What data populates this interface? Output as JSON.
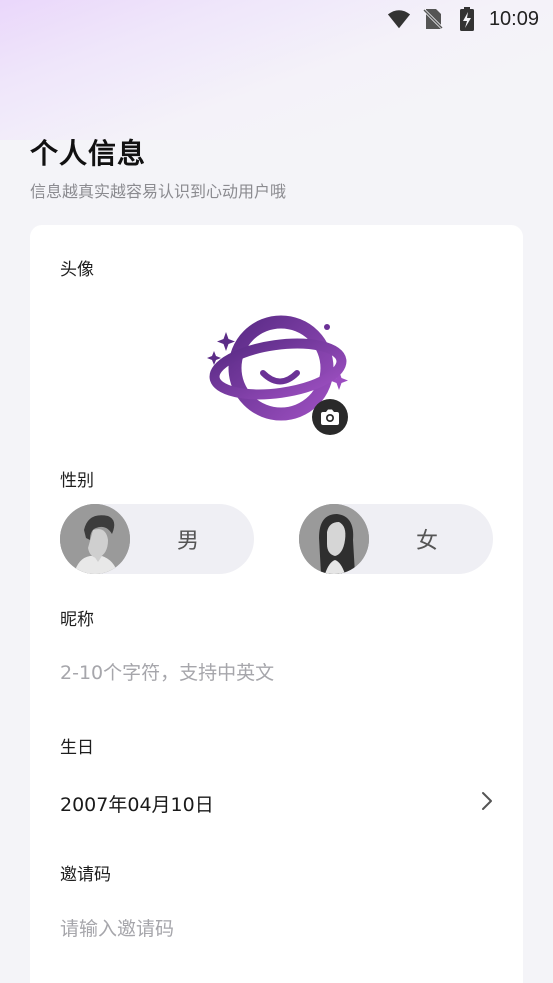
{
  "status_bar": {
    "time": "10:09",
    "icons": [
      "wifi-icon",
      "no-sim-icon",
      "battery-charging-icon"
    ]
  },
  "header": {
    "title": "个人信息",
    "subtitle": "信息越真实越容易认识到心动用户哦"
  },
  "form": {
    "avatar": {
      "label": "头像",
      "icon": "planet-logo-icon",
      "camera_icon": "camera-icon"
    },
    "gender": {
      "label": "性别",
      "options": [
        {
          "label": "男",
          "icon": "male-avatar"
        },
        {
          "label": "女",
          "icon": "female-avatar"
        }
      ]
    },
    "nickname": {
      "label": "昵称",
      "value": "",
      "placeholder": "2-10个字符，支持中英文"
    },
    "birthday": {
      "label": "生日",
      "value": "2007年04月10日",
      "icon": "chevron-right-icon"
    },
    "invite_code": {
      "label": "邀请码",
      "value": "",
      "placeholder": "请输入邀请码"
    }
  },
  "colors": {
    "brand_purple": "#7a3aa6",
    "background": "#f4f4f8",
    "card": "#ffffff"
  }
}
